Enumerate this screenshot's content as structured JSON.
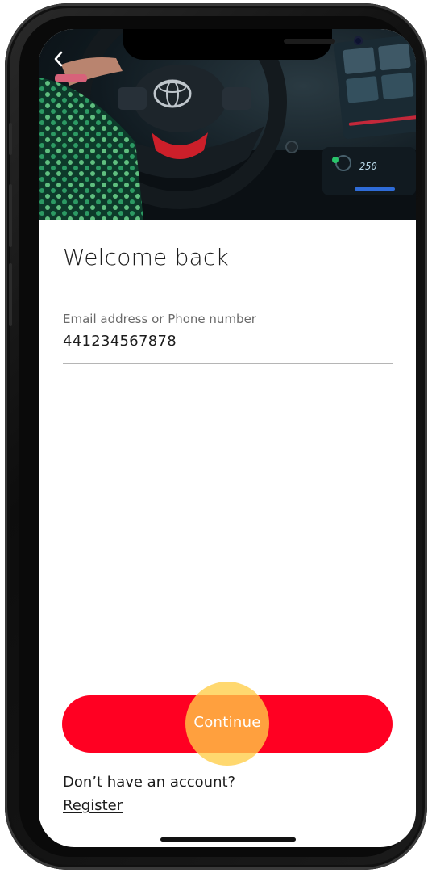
{
  "header": {
    "back_icon": "chevron-left-icon"
  },
  "main": {
    "title": "Welcome back",
    "identifier_field": {
      "label": "Email address or Phone number",
      "value": "441234567878"
    },
    "continue_label": "Continue",
    "no_account_text": "Don’t have an account?",
    "register_label": "Register"
  },
  "colors": {
    "accent": "#ff0022",
    "tap_indicator": "#ffcd46",
    "text": "#1c1c1c"
  }
}
